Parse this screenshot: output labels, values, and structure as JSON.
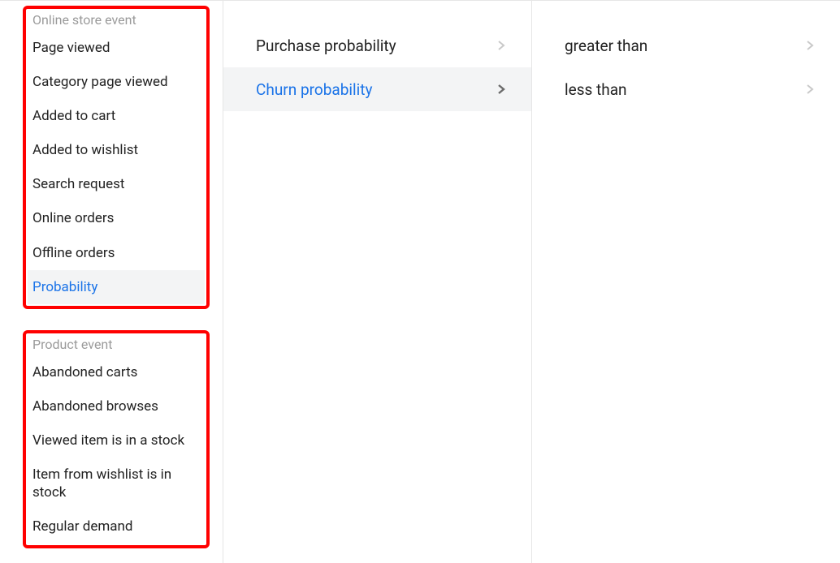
{
  "sidebar": {
    "groups": [
      {
        "title": "Online store event",
        "items": [
          {
            "label": "Page viewed",
            "selected": false
          },
          {
            "label": "Category page viewed",
            "selected": false
          },
          {
            "label": "Added to cart",
            "selected": false
          },
          {
            "label": "Added to wishlist",
            "selected": false
          },
          {
            "label": "Search request",
            "selected": false
          },
          {
            "label": "Online orders",
            "selected": false
          },
          {
            "label": "Offline orders",
            "selected": false
          },
          {
            "label": "Probability",
            "selected": true
          }
        ]
      },
      {
        "title": "Product event",
        "items": [
          {
            "label": "Abandoned carts",
            "selected": false
          },
          {
            "label": "Abandoned browses",
            "selected": false
          },
          {
            "label": "Viewed item is in a stock",
            "selected": false
          },
          {
            "label": "Item from wishlist is in stock",
            "selected": false
          },
          {
            "label": "Regular demand",
            "selected": false
          }
        ]
      }
    ]
  },
  "middle": {
    "items": [
      {
        "label": "Purchase probability",
        "selected": false
      },
      {
        "label": "Churn probability",
        "selected": true
      }
    ]
  },
  "right": {
    "items": [
      {
        "label": "greater than",
        "selected": false
      },
      {
        "label": "less than",
        "selected": false
      }
    ]
  }
}
